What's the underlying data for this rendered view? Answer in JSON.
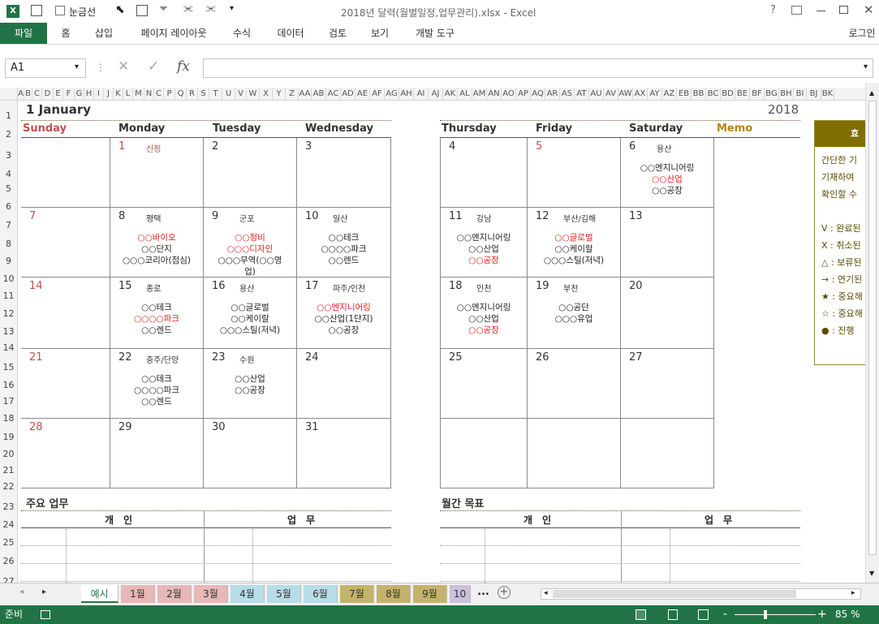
{
  "window": {
    "title": "2018년 달력(월별일정,업무관리).xlsx - Excel",
    "gridlines_label": "눈금선",
    "help": "?",
    "user": "로그인"
  },
  "ribbon": {
    "tabs": [
      "파일",
      "홈",
      "삽입",
      "페이지 레이아웃",
      "수식",
      "데이터",
      "검토",
      "보기",
      "개발 도구"
    ]
  },
  "formula": {
    "name_box": "A1",
    "fx": "fx",
    "value": ""
  },
  "columns": [
    "A",
    "B",
    "C",
    "D",
    "E",
    "F",
    "G",
    "H",
    "I",
    "J",
    "K",
    "L",
    "M",
    "N",
    "C",
    "P",
    "Q",
    "R",
    "S",
    "T",
    "U",
    "V",
    "W",
    "X",
    "Y",
    "Z",
    "AA",
    "AB",
    "AC",
    "AD",
    "AE",
    "AF",
    "AG",
    "AH",
    "AI",
    "AJ",
    "AK",
    "AL",
    "AM",
    "AN",
    "AO",
    "AP",
    "AQ",
    "AR",
    "AS",
    "AT",
    "AU",
    "AV",
    "AW",
    "AX",
    "AY",
    "AZ",
    "EB",
    "BB",
    "BC",
    "BD",
    "BE",
    "BF",
    "BG",
    "BH",
    "BI",
    "BJ",
    "BK"
  ],
  "rows": [
    "1",
    "2",
    "3",
    "4",
    "5",
    "6",
    "7",
    "8",
    "9",
    "10",
    "11",
    "12",
    "13",
    "14",
    "15",
    "16",
    "17",
    "18",
    "19",
    "20",
    "21",
    "22",
    "23",
    "24",
    "25",
    "26",
    "27",
    "28"
  ],
  "calendar": {
    "month_title": "1 January",
    "year": "2018",
    "days_left": [
      "Sunday",
      "Monday",
      "Tuesday",
      "Wednesday"
    ],
    "days_right": [
      "Thursday",
      "Friday",
      "Saturday"
    ],
    "memo": "Memo",
    "weeks": [
      [
        {
          "d": "",
          "red": false
        },
        {
          "d": "1",
          "red": true,
          "loc": "신정",
          "lines": []
        },
        {
          "d": "2",
          "lines": []
        },
        {
          "d": "3",
          "lines": []
        },
        {
          "d": "4",
          "lines": []
        },
        {
          "d": "5",
          "red": true,
          "lines": []
        },
        {
          "d": "6",
          "loc": "용산",
          "lines": [
            {
              "t": "○○엔지니어링"
            },
            {
              "t": "○○산업",
              "r": true
            },
            {
              "t": "○○공장"
            }
          ]
        }
      ],
      [
        {
          "d": "7",
          "red": true
        },
        {
          "d": "8",
          "loc": "평택",
          "lines": [
            {
              "t": "○○바이오",
              "r": true
            },
            {
              "t": "○○단지"
            },
            {
              "t": "○○○코리아(점심)"
            }
          ]
        },
        {
          "d": "9",
          "loc": "군포",
          "lines": [
            {
              "t": "○○정비",
              "r": true
            },
            {
              "t": "○○○디자인",
              "r": true
            },
            {
              "t": "○○○무역(○○영"
            },
            {
              "t": "업)"
            }
          ]
        },
        {
          "d": "10",
          "loc": "일산",
          "lines": [
            {
              "t": "○○테크"
            },
            {
              "t": "○○○○파크"
            },
            {
              "t": "○○렌드"
            }
          ]
        },
        {
          "d": "11",
          "loc": "강남",
          "lines": [
            {
              "t": "○○엔지니어링"
            },
            {
              "t": "○○산업"
            },
            {
              "t": "○○공장",
              "r": true
            }
          ]
        },
        {
          "d": "12",
          "loc": "부산/김해",
          "lines": [
            {
              "t": "○○글로벌",
              "r": true
            },
            {
              "t": "○○케이랄"
            },
            {
              "t": "○○○스틸(저녁)"
            }
          ]
        },
        {
          "d": "13",
          "lines": []
        }
      ],
      [
        {
          "d": "14",
          "red": true
        },
        {
          "d": "15",
          "loc": "종로",
          "lines": [
            {
              "t": "○○테크"
            },
            {
              "t": "○○○○파크",
              "r": true
            },
            {
              "t": "○○렌드"
            }
          ]
        },
        {
          "d": "16",
          "loc": "용산",
          "lines": [
            {
              "t": "○○글로벌"
            },
            {
              "t": "○○케이랄"
            },
            {
              "t": "○○○스틸(저녁)"
            }
          ]
        },
        {
          "d": "17",
          "loc": "파주/인천",
          "lines": [
            {
              "t": "○○엔지니어링",
              "r": true
            },
            {
              "t": "○○산업(1단지)"
            },
            {
              "t": "○○공장"
            }
          ]
        },
        {
          "d": "18",
          "loc": "인천",
          "lines": [
            {
              "t": "○○엔지니어링"
            },
            {
              "t": "○○산업"
            },
            {
              "t": "○○공장",
              "r": true
            }
          ]
        },
        {
          "d": "19",
          "loc": "부천",
          "lines": [
            {
              "t": "○○공단"
            },
            {
              "t": "○○○유업"
            }
          ]
        },
        {
          "d": "20",
          "lines": []
        }
      ],
      [
        {
          "d": "21",
          "red": true
        },
        {
          "d": "22",
          "loc": "충주/단양",
          "lines": [
            {
              "t": "○○테크"
            },
            {
              "t": "○○○○파크"
            },
            {
              "t": "○○렌드"
            }
          ]
        },
        {
          "d": "23",
          "loc": "수원",
          "lines": [
            {
              "t": "○○산업"
            },
            {
              "t": "○○공장"
            }
          ]
        },
        {
          "d": "24",
          "lines": []
        },
        {
          "d": "25",
          "lines": []
        },
        {
          "d": "26",
          "lines": []
        },
        {
          "d": "27",
          "lines": []
        }
      ],
      [
        {
          "d": "28",
          "red": true
        },
        {
          "d": "29",
          "lines": []
        },
        {
          "d": "30",
          "lines": []
        },
        {
          "d": "31",
          "lines": []
        },
        {
          "d": "",
          "lines": []
        },
        {
          "d": "",
          "lines": []
        },
        {
          "d": "",
          "lines": []
        }
      ]
    ],
    "tasks_title": "주요 업무",
    "goals_title": "월간 목표",
    "personal": "개　인",
    "work": "업　무"
  },
  "memo_box": {
    "head": "효",
    "lines": [
      "간단한 기",
      "기재하여",
      "확인할 수",
      "",
      "V : 완료된",
      "X : 취소된",
      "△ : 보류된",
      "→ : 연기된",
      "★ : 중요해",
      "☆ : 중요해",
      "● : 진행"
    ]
  },
  "sheets": {
    "tabs": [
      {
        "label": "예시",
        "color": "#fff2cc",
        "active": true
      },
      {
        "label": "1월",
        "color": "#e6b8b7"
      },
      {
        "label": "2월",
        "color": "#e6b8b7"
      },
      {
        "label": "3월",
        "color": "#e6b8b7"
      },
      {
        "label": "4월",
        "color": "#b7dee8"
      },
      {
        "label": "5월",
        "color": "#b7dee8"
      },
      {
        "label": "6월",
        "color": "#b7dee8"
      },
      {
        "label": "7월",
        "color": "#c4b36a"
      },
      {
        "label": "8월",
        "color": "#c4b36a"
      },
      {
        "label": "9월",
        "color": "#c4b36a"
      },
      {
        "label": "10",
        "color": "#ccc0da"
      }
    ],
    "more": "...",
    "add": "+"
  },
  "status": {
    "ready": "준비",
    "zoom": "85 %",
    "minus": "-",
    "plus": "+"
  }
}
